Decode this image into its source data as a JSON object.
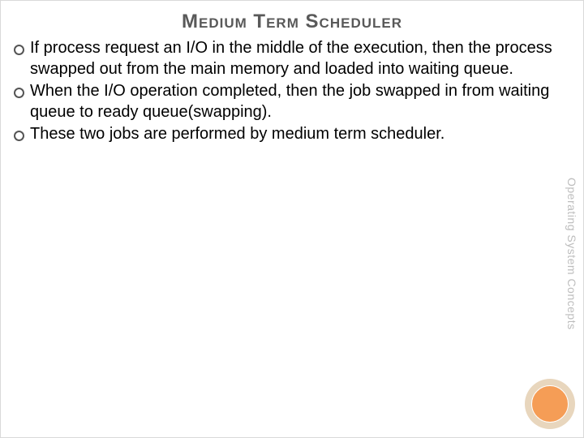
{
  "title": "Medium Term Scheduler",
  "bullets": [
    "If process request an I/O in the middle of the execution, then the process swapped out from the main memory and loaded into waiting queue.",
    "When the I/O operation completed, then the job swapped in from waiting queue to ready queue(swapping).",
    "These two jobs are performed by medium term scheduler."
  ],
  "side_label": "Operating System Concepts",
  "colors": {
    "title": "#595959",
    "side_label": "#bdbdbd",
    "circle_outer": "#e8d6bd",
    "circle_inner": "#f59d56"
  }
}
